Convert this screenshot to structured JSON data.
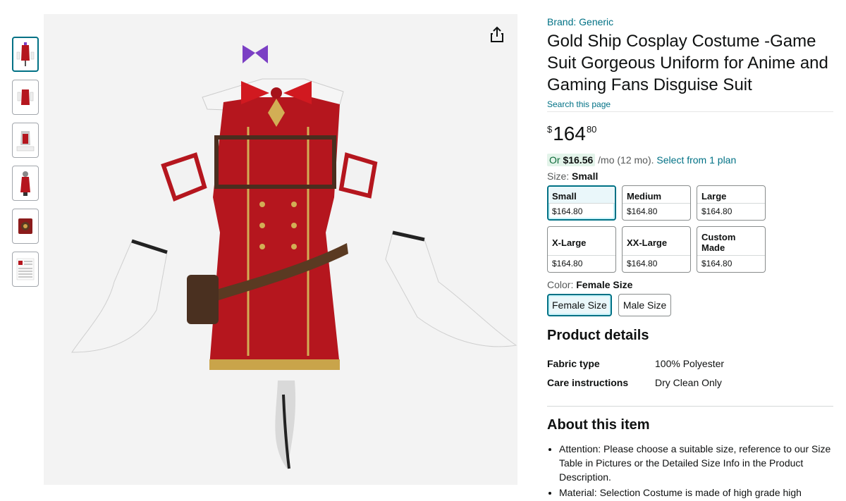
{
  "gallery": {
    "thumbnails": [
      "thumb-1",
      "thumb-2",
      "thumb-3",
      "thumb-4",
      "thumb-5",
      "thumb-6"
    ],
    "active_index": 0,
    "share_icon": "share-icon"
  },
  "product": {
    "brand": "Brand: Generic",
    "title": "Gold Ship Cosplay Costume -Game Suit Gorgeous Uniform for Anime and Gaming Fans Disguise Suit",
    "search_link": "Search this page",
    "price": {
      "symbol": "$",
      "whole": "164",
      "fraction": "80"
    },
    "installment": {
      "or": "Or",
      "amount": "$16.56",
      "term": "/mo (12 mo).",
      "plan_link": "Select from 1 plan"
    }
  },
  "size": {
    "label": "Size:",
    "selected": "Small",
    "options": [
      {
        "name": "Small",
        "price": "$164.80"
      },
      {
        "name": "Medium",
        "price": "$164.80"
      },
      {
        "name": "Large",
        "price": "$164.80"
      },
      {
        "name": "X-Large",
        "price": "$164.80"
      },
      {
        "name": "XX-Large",
        "price": "$164.80"
      },
      {
        "name": "Custom Made",
        "price": "$164.80"
      }
    ]
  },
  "color": {
    "label": "Color:",
    "selected": "Female Size",
    "options": [
      "Female Size",
      "Male Size"
    ]
  },
  "details": {
    "heading": "Product details",
    "rows": [
      {
        "key": "Fabric type",
        "value": "100% Polyester"
      },
      {
        "key": "Care instructions",
        "value": "Dry Clean Only"
      }
    ]
  },
  "about": {
    "heading": "About this item",
    "bullets": [
      "Attention: Please choose a suitable size, reference to our Size Table in Pictures or the Detailed Size Info in the Product Description.",
      "Material: Selection Costume is made of high grade high"
    ]
  },
  "colors": {
    "link": "#007185",
    "selected_border": "#007185",
    "install_bg": "#e3f4ea"
  }
}
